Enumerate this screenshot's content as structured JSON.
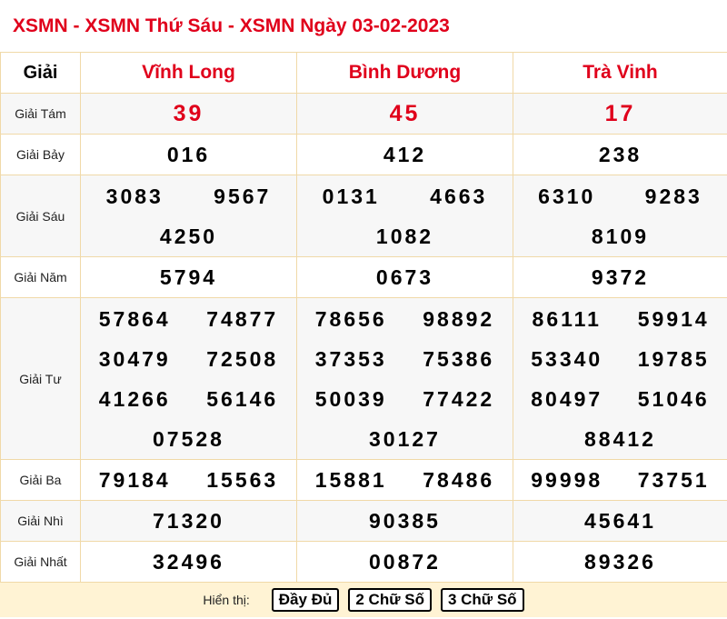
{
  "title": "XSMN - XSMN Thứ Sáu - XSMN Ngày 03-02-2023",
  "header": {
    "label": "Giải",
    "provinces": [
      "Vĩnh Long",
      "Bình Dương",
      "Trà Vinh"
    ]
  },
  "prizes": [
    {
      "name": "Giải Tám",
      "cols": [
        [
          "39"
        ],
        [
          "45"
        ],
        [
          "17"
        ]
      ]
    },
    {
      "name": "Giải Bảy",
      "cols": [
        [
          "016"
        ],
        [
          "412"
        ],
        [
          "238"
        ]
      ]
    },
    {
      "name": "Giải Sáu",
      "cols": [
        [
          "3083",
          "9567",
          "4250"
        ],
        [
          "0131",
          "4663",
          "1082"
        ],
        [
          "6310",
          "9283",
          "8109"
        ]
      ]
    },
    {
      "name": "Giải Năm",
      "cols": [
        [
          "5794"
        ],
        [
          "0673"
        ],
        [
          "9372"
        ]
      ]
    },
    {
      "name": "Giải Tư",
      "cols": [
        [
          "57864",
          "74877",
          "30479",
          "72508",
          "41266",
          "56146",
          "07528"
        ],
        [
          "78656",
          "98892",
          "37353",
          "75386",
          "50039",
          "77422",
          "30127"
        ],
        [
          "86111",
          "59914",
          "53340",
          "19785",
          "80497",
          "51046",
          "88412"
        ]
      ]
    },
    {
      "name": "Giải Ba",
      "cols": [
        [
          "79184",
          "15563"
        ],
        [
          "15881",
          "78486"
        ],
        [
          "99998",
          "73751"
        ]
      ]
    },
    {
      "name": "Giải Nhì",
      "cols": [
        [
          "71320"
        ],
        [
          "90385"
        ],
        [
          "45641"
        ]
      ]
    },
    {
      "name": "Giải Nhất",
      "cols": [
        [
          "32496"
        ],
        [
          "00872"
        ],
        [
          "89326"
        ]
      ]
    }
  ],
  "footer": {
    "label": "Hiển thị:",
    "buttons": [
      "Đầy Đủ",
      "2 Chữ Số",
      "3 Chữ Số"
    ]
  }
}
